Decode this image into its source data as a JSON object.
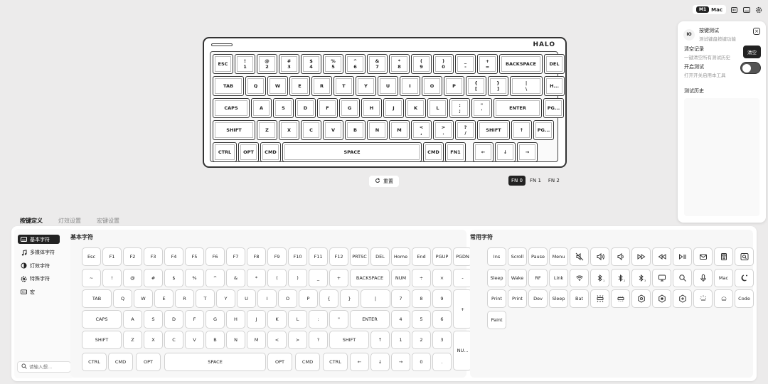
{
  "topbar": {
    "mode_badge": "M1",
    "mode_label": "Mac",
    "icons": [
      "battery-icon",
      "window-icon",
      "settings-icon"
    ]
  },
  "keyboard": {
    "logo": "HALO",
    "rows": [
      [
        "ESC",
        "!\n1",
        "@\n2",
        "#\n3",
        "$\n4",
        "%\n5",
        "^\n6",
        "&\n7",
        "*\n8",
        "(\n9",
        ")\n0",
        "_\n-",
        "+\n=",
        "BACKSPACE",
        "DEL"
      ],
      [
        "TAB",
        "Q",
        "W",
        "E",
        "R",
        "T",
        "Y",
        "U",
        "I",
        "O",
        "P",
        "{\n[",
        "}\n]",
        "|\n\\",
        "H..."
      ],
      [
        "CAPS",
        "A",
        "S",
        "D",
        "F",
        "G",
        "H",
        "J",
        "K",
        "L",
        ":\n;",
        "\"\n'",
        "ENTER",
        "PG..."
      ],
      [
        "SHIFT",
        "Z",
        "X",
        "C",
        "V",
        "B",
        "N",
        "M",
        "<\n,",
        ">\n.",
        "?\n/",
        "SHIFT",
        "↑",
        "PG..."
      ],
      [
        "CTRL",
        "OPT",
        "CMD",
        "SPACE",
        "CMD",
        "FN1",
        "←",
        "↓",
        "→"
      ]
    ]
  },
  "reset_label": "重置",
  "fn_layers": [
    "FN 0",
    "FN 1",
    "FN 2"
  ],
  "fn_active": 0,
  "panel": {
    "badge": "IO",
    "title": "按键测试",
    "subtitle": "测试键盘按键功能",
    "clear_title": "清空记录",
    "clear_desc": "一键清空所有测试历史",
    "clear_button": "清空",
    "enable_title": "开启测试",
    "enable_desc": "打开开关启用本工具",
    "enable_on": false,
    "history_title": "测试历史"
  },
  "tabs": [
    "按键定义",
    "灯效设置",
    "宏键设置"
  ],
  "tab_active": 0,
  "sidebar": {
    "items": [
      {
        "label": "基本字符",
        "icon": "keyboard-icon"
      },
      {
        "label": "多媒体字符",
        "icon": "music-note-icon"
      },
      {
        "label": "灯效字符",
        "icon": "light-icon"
      },
      {
        "label": "特殊字符",
        "icon": "gear-icon"
      },
      {
        "label": "宏",
        "icon": "macro-icon"
      }
    ],
    "active": 0,
    "search_placeholder": "请输入想..."
  },
  "basic": {
    "title": "基本字符",
    "rows": [
      [
        "Esc",
        "F1",
        "F2",
        "F3",
        "F4",
        "F5",
        "F6",
        "F7",
        "F8",
        "F9",
        "F10",
        "F11",
        "F12",
        "PRTSC",
        "DEL",
        "Home",
        "End",
        "PGUP",
        "PGDN"
      ],
      [
        "~",
        "!",
        "@",
        "#",
        "$",
        "%",
        "^",
        "&",
        "*",
        "(",
        ")",
        "_",
        "+",
        "BACKSPACE",
        "NUM",
        "÷",
        "×",
        "-"
      ],
      [
        "TAB",
        "Q",
        "W",
        "E",
        "R",
        "T",
        "Y",
        "U",
        "I",
        "O",
        "P",
        "{",
        "}",
        "|",
        "7",
        "8",
        "9",
        "+"
      ],
      [
        "CAPS",
        "A",
        "S",
        "D",
        "F",
        "G",
        "H",
        "J",
        "K",
        "L",
        ":",
        "\"",
        "ENTER",
        "4",
        "5",
        "6"
      ],
      [
        "SHIFT",
        "Z",
        "X",
        "C",
        "V",
        "B",
        "N",
        "M",
        "<",
        ">",
        "?",
        "SHIFT",
        "↑",
        "1",
        "2",
        "3",
        "NU..."
      ],
      [
        "CTRL",
        "CMD",
        "OPT",
        "SPACE",
        "OPT",
        "CMD",
        "CTRL",
        "←",
        "↓",
        "→",
        "0",
        "."
      ]
    ]
  },
  "common": {
    "title": "常用字符",
    "rows": [
      [
        "Ins",
        "Scroll",
        "Pause",
        "Menu",
        "mute-icon",
        "volume-up-icon",
        "volume-down-icon",
        "fast-forward-icon",
        "rewind-icon",
        "play-pause-icon",
        "mail-icon",
        "calculator-icon",
        "browser-search-icon"
      ],
      [
        "Sleep",
        "Wake",
        "RF",
        "Link",
        "wifi-2g-icon",
        "bluetooth-1-icon",
        "bluetooth-2-icon",
        "bluetooth-3-icon",
        "monitor-icon",
        "search-icon",
        "microphone-icon",
        "Mac",
        "night-icon"
      ],
      [
        "Print",
        "Print",
        "Dev",
        "Sleep",
        "Bat",
        "backlight-up-icon",
        "backlight-down-icon",
        "hex-1-icon",
        "hex-2-icon",
        "hex-3-icon",
        "brightness-up-icon",
        "brightness-down-icon",
        "Code"
      ],
      [
        "Paint"
      ]
    ]
  }
}
